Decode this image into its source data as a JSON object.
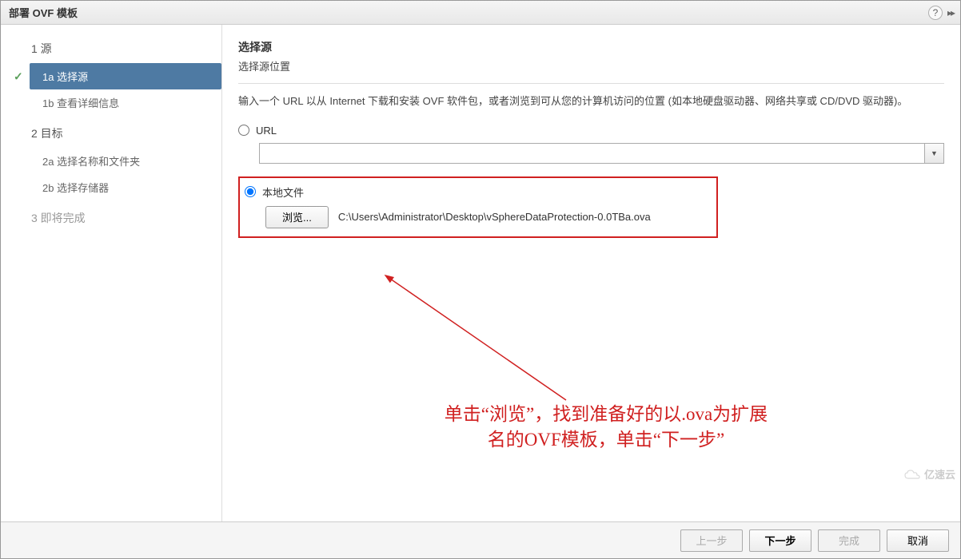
{
  "titlebar": {
    "title": "部署 OVF 模板",
    "help_tooltip": "帮助"
  },
  "sidebar": {
    "step1": {
      "header": "1 源",
      "items": [
        {
          "key": "1a",
          "label": "1a 选择源",
          "active": true,
          "completed": true
        },
        {
          "key": "1b",
          "label": "1b 查看详细信息"
        }
      ]
    },
    "step2": {
      "header": "2 目标",
      "items": [
        {
          "key": "2a",
          "label": "2a 选择名称和文件夹"
        },
        {
          "key": "2b",
          "label": "2b 选择存储器"
        }
      ]
    },
    "step3": {
      "header": "3 即将完成"
    }
  },
  "main": {
    "title": "选择源",
    "subtitle": "选择源位置",
    "description": "输入一个 URL 以从 Internet 下载和安装 OVF 软件包，或者浏览到可从您的计算机访问的位置 (如本地硬盘驱动器、网络共享或 CD/DVD 驱动器)。",
    "url": {
      "label": "URL",
      "value": ""
    },
    "local": {
      "label": "本地文件",
      "browse_label": "浏览...",
      "file_path": "C:\\Users\\Administrator\\Desktop\\vSphereDataProtection-0.0TBa.ova"
    }
  },
  "annotation": {
    "line1": "单击“浏览”，找到准备好的以.ova为扩展",
    "line2": "名的OVF模板，单击“下一步”"
  },
  "footer": {
    "back": "上一步",
    "next": "下一步",
    "finish": "完成",
    "cancel": "取消"
  },
  "watermark": "亿速云"
}
